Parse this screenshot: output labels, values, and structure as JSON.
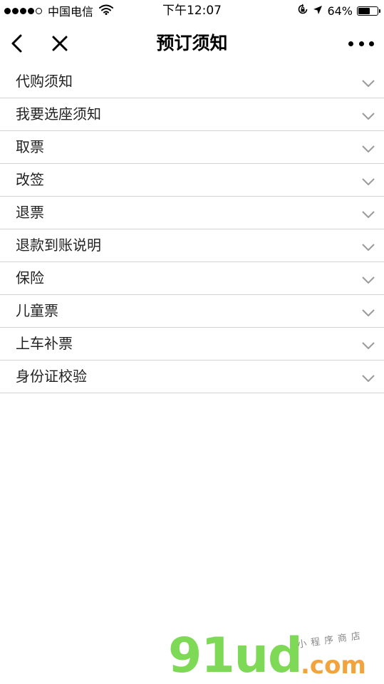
{
  "status_bar": {
    "carrier": "中国电信",
    "time": "下午12:07",
    "battery_percent": "64%",
    "battery_level": 0.64,
    "icons": [
      "signal-dots",
      "wifi-icon",
      "rotation-lock-icon",
      "location-arrow-icon",
      "battery-icon"
    ]
  },
  "nav": {
    "title": "预订须知",
    "back_icon": "chevron-left-icon",
    "close_icon": "close-icon",
    "more_icon": "more-dots-icon"
  },
  "items": [
    {
      "label": "代购须知"
    },
    {
      "label": "我要选座须知"
    },
    {
      "label": "取票"
    },
    {
      "label": "改签"
    },
    {
      "label": "退票"
    },
    {
      "label": "退款到账说明"
    },
    {
      "label": "保险"
    },
    {
      "label": "儿童票"
    },
    {
      "label": "上车补票"
    },
    {
      "label": "身份证校验"
    }
  ],
  "watermark": {
    "main": "91ud",
    "domain": ".com",
    "tagline": "小程序商店"
  },
  "colors": {
    "divider": "#d3d3d3",
    "chevron": "#9a9a9a",
    "watermark_green": "#7ed957",
    "watermark_orange": "#f2a33c"
  }
}
